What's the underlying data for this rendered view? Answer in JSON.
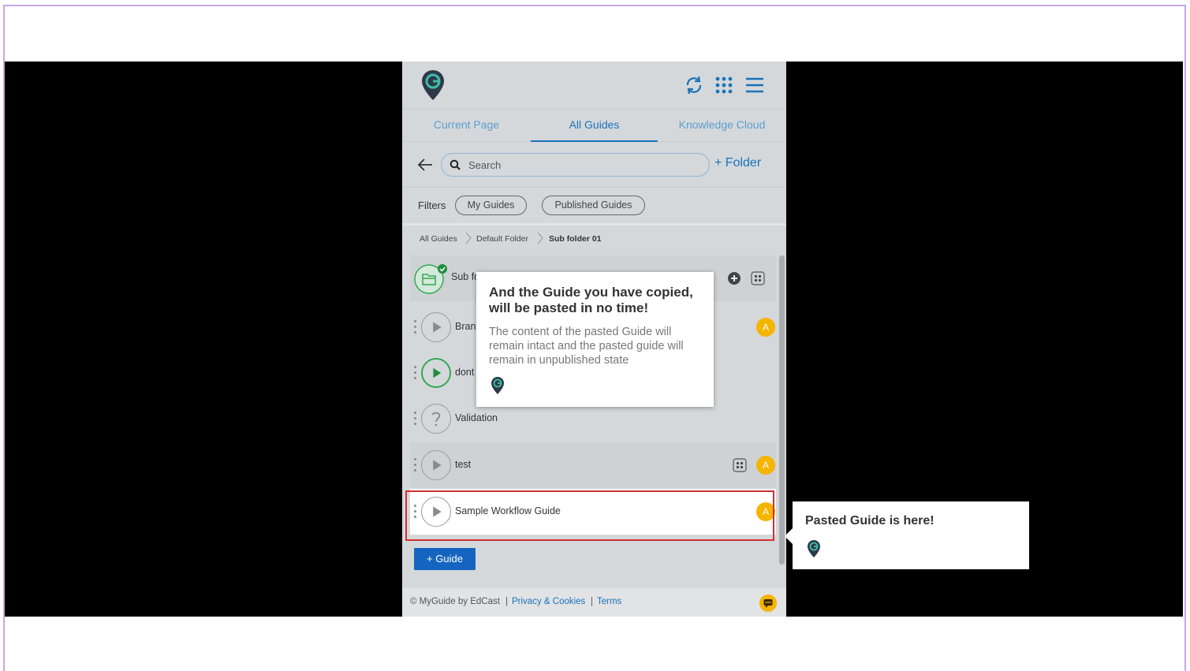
{
  "header": {
    "logo": "myguide-logo-icon",
    "icons": [
      "refresh-icon",
      "apps-grid-icon",
      "hamburger-menu-icon"
    ]
  },
  "tabs": [
    {
      "label": "Current Page"
    },
    {
      "label": "All Guides"
    },
    {
      "label": "Knowledge Cloud"
    }
  ],
  "active_tab": "All Guides",
  "search": {
    "placeholder": "Search",
    "add_folder_label": "+ Folder"
  },
  "filters": {
    "label": "Filters",
    "chips": [
      "My Guides",
      "Published Guides"
    ]
  },
  "breadcrumb": [
    "All Guides",
    "Default Folder",
    "Sub folder 01"
  ],
  "list": {
    "folder_label": "Sub fo",
    "rows": [
      {
        "label": "Bran",
        "badge": "A"
      },
      {
        "label": "dont"
      },
      {
        "label": "Validation"
      },
      {
        "label": "test",
        "badge": "A"
      },
      {
        "label": "Sample Workflow Guide",
        "badge": "A"
      }
    ]
  },
  "add_guide_label": "+ Guide",
  "footer": {
    "copyright": "© MyGuide by EdCast",
    "sep": "|",
    "privacy": "Privacy & Cookies",
    "terms": "Terms"
  },
  "tooltip_main": {
    "title": "And the Guide you have copied, will be pasted in no time!",
    "body": "The content of the pasted Guide will remain intact and the pasted guide will remain in unpublished state"
  },
  "tooltip_side": {
    "title": "Pasted Guide is here!"
  },
  "colors": {
    "accent": "#1a73b8",
    "badge": "#f5b400",
    "highlight": "#d32f2f",
    "panel": "#d5d8db"
  }
}
